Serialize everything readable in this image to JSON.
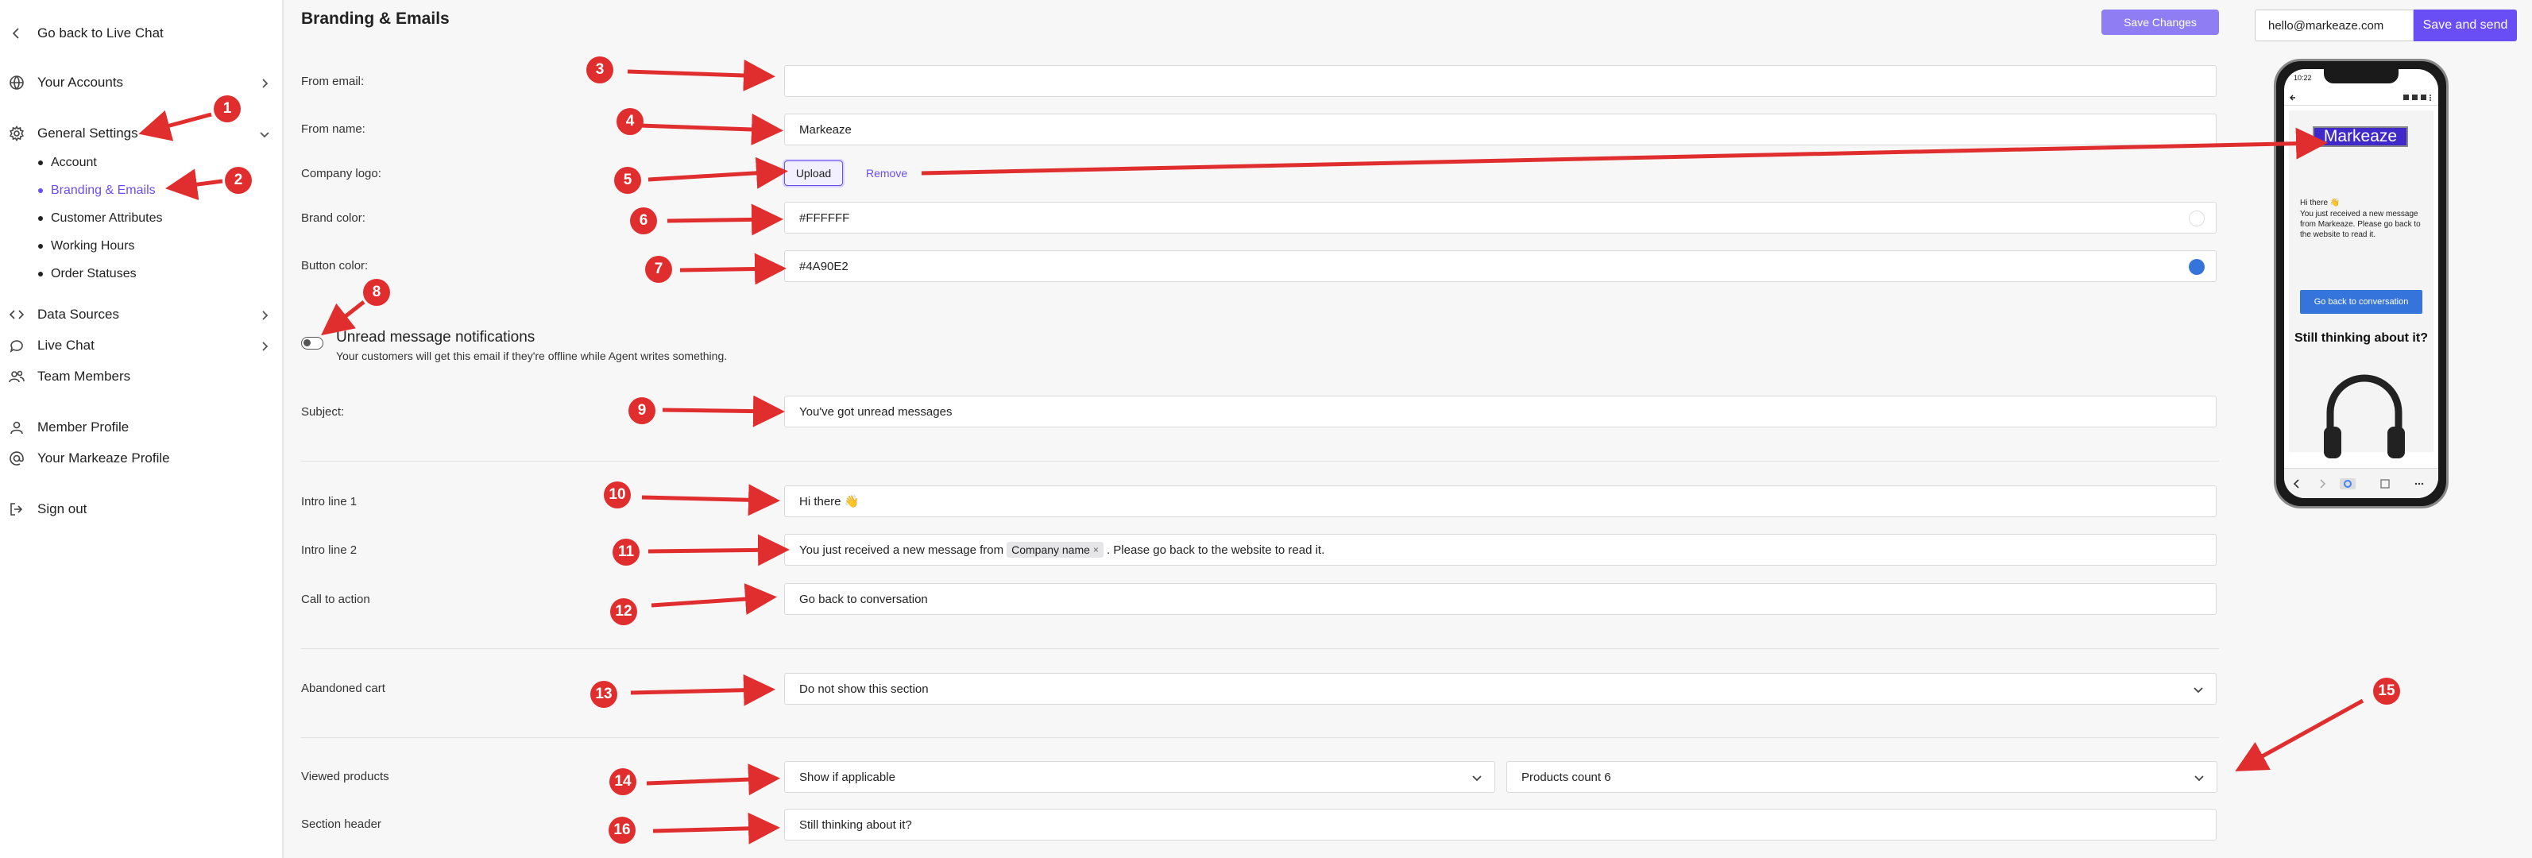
{
  "sidebar": {
    "back_label": "Go back to Live Chat",
    "items": [
      {
        "label": "Your Accounts"
      },
      {
        "label": "General Settings"
      },
      {
        "label": "Data Sources"
      },
      {
        "label": "Live Chat"
      },
      {
        "label": "Team Members"
      },
      {
        "label": "Member Profile"
      },
      {
        "label": "Your Markeaze Profile"
      },
      {
        "label": "Sign out"
      }
    ],
    "sub_items": [
      {
        "label": "Account"
      },
      {
        "label": "Branding & Emails",
        "active": true
      },
      {
        "label": "Customer Attributes"
      },
      {
        "label": "Working Hours"
      },
      {
        "label": "Order Statuses"
      }
    ]
  },
  "header": {
    "title": "Branding & Emails",
    "save_label": "Save Changes"
  },
  "form": {
    "from_email": {
      "label": "From email:",
      "value": ""
    },
    "from_name": {
      "label": "From name:",
      "value": "Markeaze"
    },
    "company_logo": {
      "label": "Company logo:",
      "upload_label": "Upload",
      "remove_label": "Remove"
    },
    "brand_color": {
      "label": "Brand color:",
      "value": "#FFFFFF",
      "color": "#FFFFFF"
    },
    "button_color": {
      "label": "Button color:",
      "value": "#4A90E2",
      "color": "#3474db"
    },
    "notifications": {
      "title": "Unread message notifications",
      "subtitle": "Your customers will get this email if they're offline while Agent writes something.",
      "enabled": false
    },
    "subject": {
      "label": "Subject:",
      "value": "You've got unread messages"
    },
    "intro1": {
      "label": "Intro line 1",
      "value": "Hi there 👋"
    },
    "intro2": {
      "label": "Intro line 2",
      "before": "You just received a new message from",
      "chip": "Company name",
      "after": ". Please go back to the website to read it."
    },
    "cta": {
      "label": "Call to action",
      "value": "Go back to conversation"
    },
    "abandoned": {
      "label": "Abandoned cart",
      "value": "Do not show this section"
    },
    "viewed": {
      "label": "Viewed products",
      "value": "Show if applicable",
      "count_value": "Products count 6"
    },
    "section_header": {
      "label": "Section header",
      "value": "Still thinking about it?"
    }
  },
  "preview": {
    "email_value": "hello@markeaze.com",
    "send_label": "Save and send",
    "time": "10:22",
    "logo_text": "Markeaze",
    "greeting": "Hi there 👋",
    "message": "You just received a new message from Markeaze. Please go back to the website to read it.",
    "button": "Go back to conversation",
    "heading": "Still thinking about it?"
  },
  "annotations": [
    "1",
    "2",
    "3",
    "4",
    "5",
    "6",
    "7",
    "8",
    "9",
    "10",
    "11",
    "12",
    "13",
    "14",
    "15",
    "16"
  ],
  "colors": {
    "accent": "#6a4ef5",
    "annotation": "#e02e2e"
  }
}
